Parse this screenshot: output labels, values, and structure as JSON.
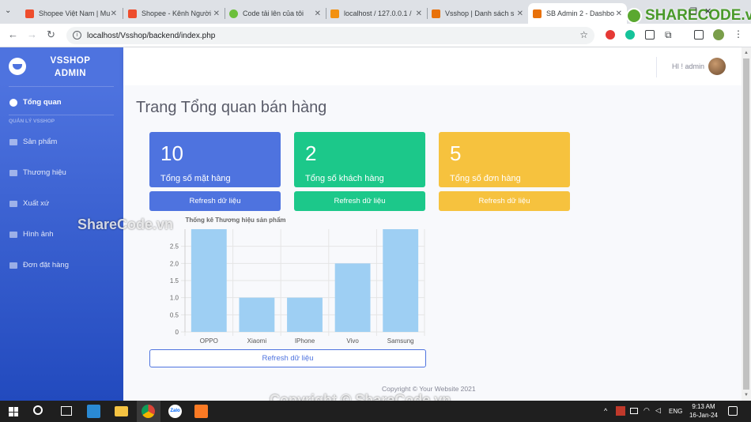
{
  "tabs": [
    {
      "title": "Shopee Việt Nam | Mu",
      "color": "#ee4d2d"
    },
    {
      "title": "Shopee - Kênh Người",
      "color": "#ee4d2d"
    },
    {
      "title": "Code tải lên của tôi",
      "color": "#6cbf3b"
    },
    {
      "title": "localhost / 127.0.0.1 /",
      "color": "#f29111"
    },
    {
      "title": "Vsshop | Danh sách s",
      "color": "#e8710a"
    },
    {
      "title": "SB Admin 2 - Dashbo",
      "color": "#e8710a"
    }
  ],
  "url": "localhost/Vsshop/backend/index.php",
  "brand": {
    "line1": "VSSHOP",
    "line2": "ADMIN"
  },
  "sidebar": {
    "dashboard": "Tổng quan",
    "section": "QUẢN LÝ VSSHOP",
    "items": [
      "Sản phẩm",
      "Thương hiệu",
      "Xuất xứ",
      "Hình ảnh",
      "Đơn đặt hàng"
    ]
  },
  "topbar": {
    "greeting": "HI ! admin"
  },
  "page": {
    "title": "Trang Tổng quan bán hàng"
  },
  "cards": [
    {
      "value": "10",
      "label": "Tổng số mặt hàng",
      "color": "#4e73df",
      "button": "Refresh dữ liệu"
    },
    {
      "value": "2",
      "label": "Tổng số khách hàng",
      "color": "#1cc88a",
      "button": "Refresh dữ liệu"
    },
    {
      "value": "5",
      "label": "Tổng số đơn hàng",
      "color": "#f6c23e",
      "button": "Refresh dữ liệu"
    }
  ],
  "chart_data": {
    "type": "bar",
    "title": "Thống kê Thương hiệu sản phẩm",
    "categories": [
      "OPPO",
      "Xiaomi",
      "IPhone",
      "Vivo",
      "Samsung"
    ],
    "values": [
      3,
      1,
      1,
      2,
      3
    ],
    "yticks": [
      "0",
      "0.5",
      "1.0",
      "1.5",
      "2.0",
      "2.5"
    ],
    "ylim": [
      0,
      3
    ],
    "color": "#9ecff3",
    "grid": true
  },
  "chart_refresh": "Refresh dữ liệu",
  "footer": "Copyright © Your Website 2021",
  "watermarks": {
    "brand": "SHARECODE.vn",
    "mid": "ShareCode.vn",
    "bottom": "Copyright © ShareCode.vn"
  },
  "taskbar": {
    "time": "9:13 AM",
    "date": "16-Jan-24",
    "lang": "ENG"
  }
}
